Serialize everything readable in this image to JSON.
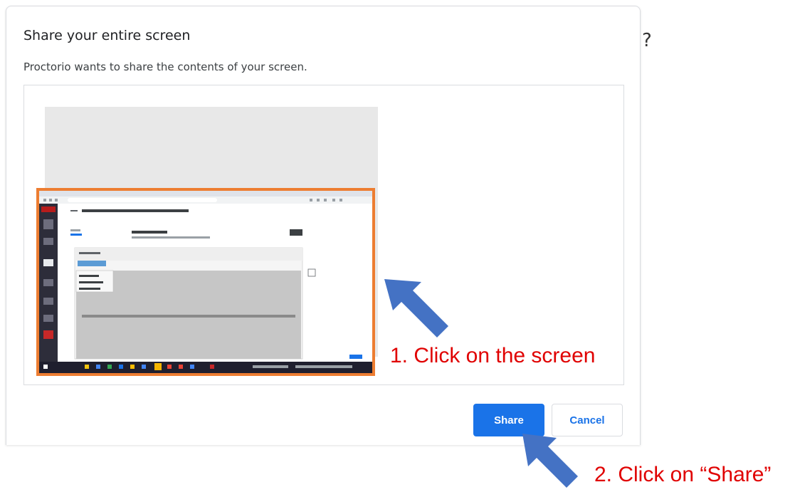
{
  "dialog": {
    "title": "Share your entire screen",
    "subtitle": "Proctorio wants to share the contents of your screen.",
    "share_label": "Share",
    "cancel_label": "Cancel"
  },
  "annotations": {
    "step1": "1.  Click on the screen",
    "step2": "2.  Click on “Share”"
  },
  "edge_glyph": "?",
  "colors": {
    "primary": "#1a73e8",
    "highlight_border": "#ed7d31",
    "annotation_text": "#e00000",
    "arrow": "#4472c4"
  }
}
